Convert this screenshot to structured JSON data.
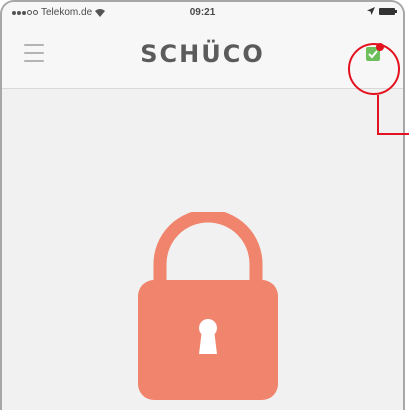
{
  "status_bar": {
    "carrier": "Telekom.de",
    "time": "09:21"
  },
  "nav_bar": {
    "brand": "SCHÜCO"
  },
  "colors": {
    "lock": "#f0846c",
    "callout": "#e2131f",
    "status_badge": "#e2131f",
    "status_icon": "#6cbf5a"
  },
  "icons": {
    "menu": "hamburger-menu-icon",
    "status": "device-status-icon",
    "lock": "padlock-locked-icon"
  }
}
